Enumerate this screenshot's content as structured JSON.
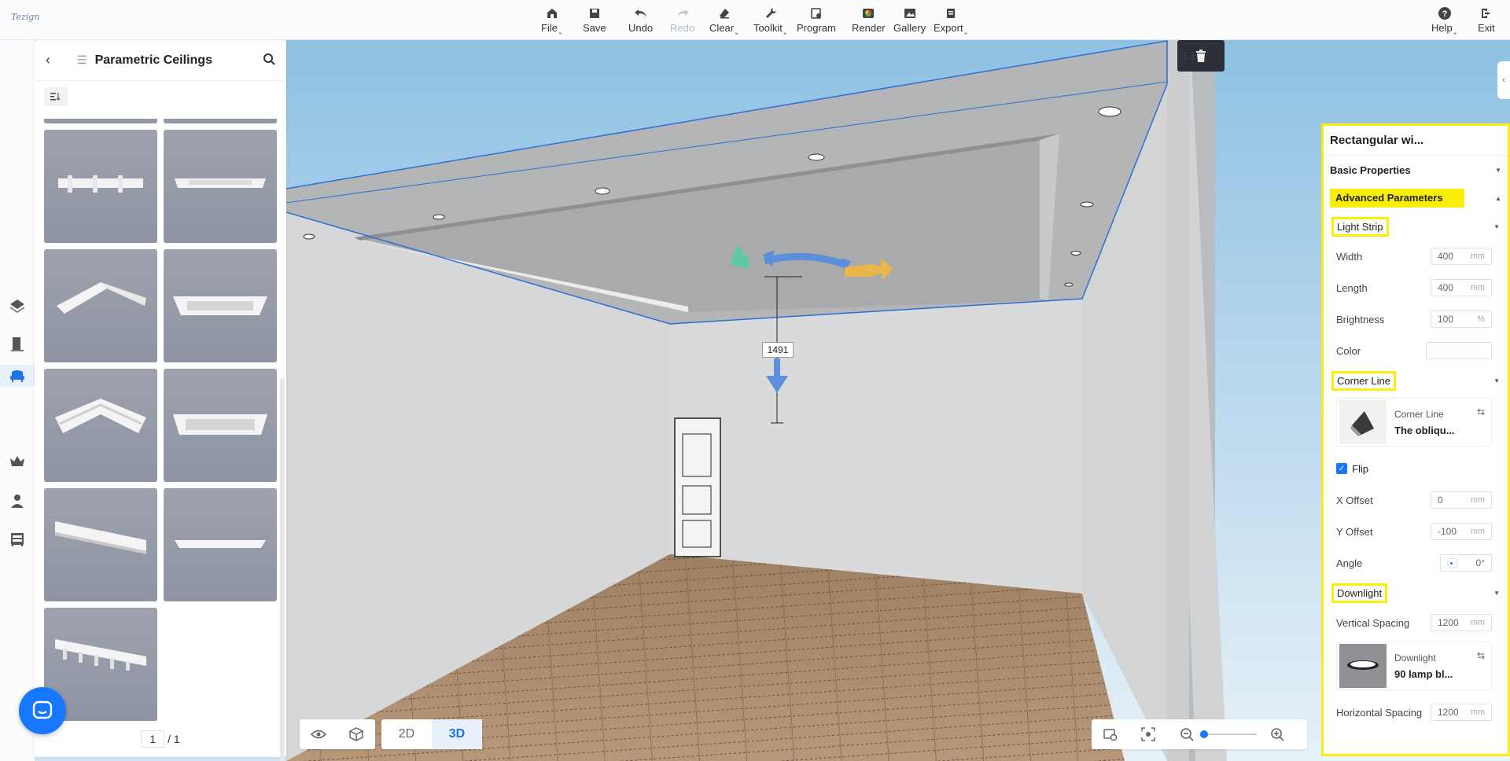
{
  "app": {
    "logo_text": "Tezign"
  },
  "toolbar": {
    "file": "File",
    "save": "Save",
    "undo": "Undo",
    "redo": "Redo",
    "clear": "Clear",
    "toolkit": "Toolkit",
    "program": "Program",
    "render": "Render",
    "gallery": "Gallery",
    "export": "Export",
    "help": "Help",
    "exit": "Exit"
  },
  "catalog": {
    "title": "Parametric Ceilings",
    "page_current": "1",
    "page_total": "/ 1"
  },
  "viewport": {
    "height_label": "1491",
    "mode_2d": "2D",
    "mode_3d": "3D"
  },
  "properties": {
    "title": "Rectangular wi...",
    "basic": "Basic Properties",
    "advanced": "Advanced Parameters",
    "light_strip": {
      "label": "Light Strip",
      "width_label": "Width",
      "width_value": "400",
      "width_unit": "mm",
      "length_label": "Length",
      "length_value": "400",
      "length_unit": "mm",
      "brightness_label": "Brightness",
      "brightness_value": "100",
      "brightness_unit": "%",
      "color_label": "Color"
    },
    "corner_line": {
      "label": "Corner Line",
      "card_type": "Corner Line",
      "card_name": "The obliqu...",
      "flip_label": "Flip",
      "flip_checked": true,
      "x_offset_label": "X Offset",
      "x_offset_value": "0",
      "x_offset_unit": "mm",
      "y_offset_label": "Y Offset",
      "y_offset_value": "-100",
      "y_offset_unit": "mm",
      "angle_label": "Angle",
      "angle_value": "0°"
    },
    "downlight": {
      "label": "Downlight",
      "vspacing_label": "Vertical Spacing",
      "vspacing_value": "1200",
      "vspacing_unit": "mm",
      "card_type": "Downlight",
      "card_name": "90 lamp bl...",
      "hspacing_label": "Horizontal Spacing",
      "hspacing_value": "1200",
      "hspacing_unit": "mm"
    }
  },
  "colors": {
    "accent": "#1677ff",
    "highlight": "#f9ef0b"
  }
}
